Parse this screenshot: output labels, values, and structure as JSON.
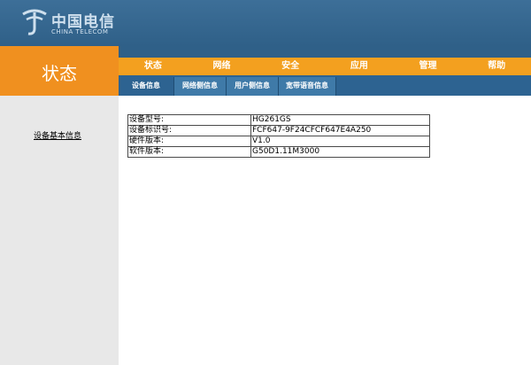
{
  "brand": {
    "name_cn": "中国电信",
    "name_en": "CHINA TELECOM",
    "logo_color": "#cfe0ee"
  },
  "page_title": "状态",
  "main_nav": [
    "状态",
    "网络",
    "安全",
    "应用",
    "管理",
    "帮助"
  ],
  "sub_nav": [
    "设备信息",
    "网络侧信息",
    "用户侧信息",
    "宽带语音信息"
  ],
  "sidebar": {
    "items": [
      "设备基本信息"
    ]
  },
  "device_info": {
    "rows": [
      {
        "label": "设备型号:",
        "value": "HG261GS"
      },
      {
        "label": "设备标识号:",
        "value": "FCF647-9F24CFCF647E4A250"
      },
      {
        "label": "硬件版本:",
        "value": "V1.0"
      },
      {
        "label": "软件版本:",
        "value": "G50D1.11M3000"
      }
    ]
  },
  "colors": {
    "header_blue": "#2f6088",
    "orange": "#f0901f",
    "nav_orange": "#f3a01f",
    "subnav_blue": "#2d6391",
    "sidebar_gray": "#e8e8e8"
  }
}
